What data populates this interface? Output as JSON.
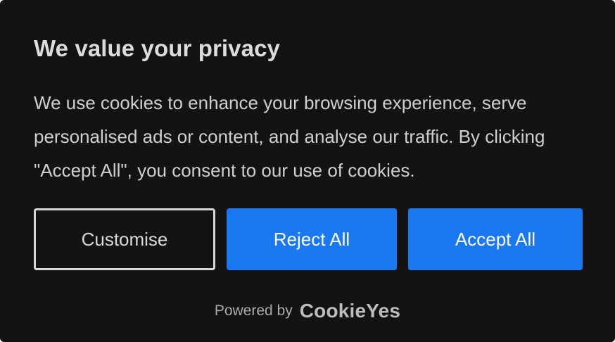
{
  "banner": {
    "title": "We value your privacy",
    "description": "We use cookies to enhance your browsing experience, serve personalised ads or content, and analyse our traffic. By clicking \"Accept All\", you consent to our use of cookies.",
    "buttons": {
      "customise": "Customise",
      "reject": "Reject All",
      "accept": "Accept All"
    },
    "footer": {
      "powered_by": "Powered by",
      "brand": "CookieYes"
    }
  },
  "colors": {
    "background": "#131313",
    "primary_button": "#1a78f2",
    "outline_button_border": "#d8d8d8"
  }
}
